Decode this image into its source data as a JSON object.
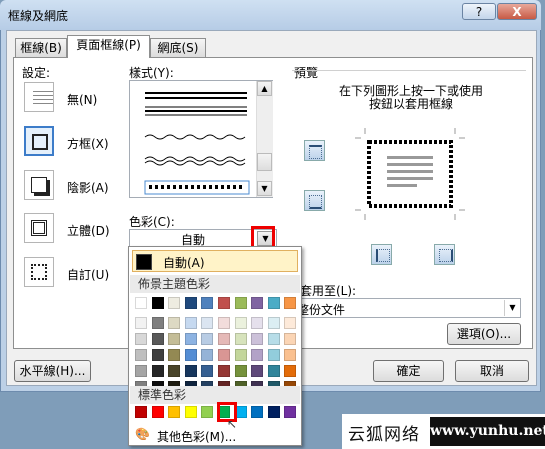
{
  "window": {
    "title": "框線及網底",
    "help": "?",
    "close": "X"
  },
  "tabs": [
    {
      "label": "框線(B)"
    },
    {
      "label": "頁面框線(P)"
    },
    {
      "label": "網底(S)"
    }
  ],
  "settings": {
    "heading": "設定:",
    "items": [
      {
        "label": "無(N)"
      },
      {
        "label": "方框(X)"
      },
      {
        "label": "陰影(A)"
      },
      {
        "label": "立體(D)"
      },
      {
        "label": "自訂(U)"
      }
    ]
  },
  "style": {
    "heading": "樣式(Y):"
  },
  "color": {
    "heading": "色彩(C):",
    "value": "自動"
  },
  "preview": {
    "heading": "預覽",
    "instruction_line1": "在下列圖形上按一下或使用",
    "instruction_line2": "按鈕以套用框線"
  },
  "apply_to": {
    "heading": "套用至(L):",
    "value": "整份文件"
  },
  "buttons": {
    "options": "選項(O)...",
    "horizontal_line": "水平線(H)...",
    "ok": "確定",
    "cancel": "取消"
  },
  "color_popup": {
    "auto_label": "自動(A)",
    "theme_heading": "佈景主題色彩",
    "standard_heading": "標準色彩",
    "more_colors": "其他色彩(M)...",
    "theme_top": [
      "#ffffff",
      "#000000",
      "#eeece1",
      "#1f497d",
      "#4f81bd",
      "#c0504d",
      "#9bbb59",
      "#8064a2",
      "#4bacc6",
      "#f79646"
    ],
    "theme_shades": [
      [
        "#f2f2f2",
        "#7f7f7f",
        "#ddd9c3",
        "#c6d9f0",
        "#dbe5f1",
        "#f2dcdb",
        "#ebf1dd",
        "#e5e0ec",
        "#dbeef3",
        "#fdeada"
      ],
      [
        "#d8d8d8",
        "#595959",
        "#c4bd97",
        "#8db3e2",
        "#b8cce4",
        "#e5b9b7",
        "#d7e3bc",
        "#ccc1d9",
        "#b7dde8",
        "#fbd5b5"
      ],
      [
        "#bfbfbf",
        "#3f3f3f",
        "#938953",
        "#548dd4",
        "#95b3d7",
        "#d99694",
        "#c3d69b",
        "#b2a2c7",
        "#92cddc",
        "#fac08f"
      ],
      [
        "#a5a5a5",
        "#262626",
        "#494429",
        "#17365d",
        "#366092",
        "#953734",
        "#76923c",
        "#5f497a",
        "#31859b",
        "#e36c09"
      ],
      [
        "#7f7f7f",
        "#0c0c0c",
        "#1d1b10",
        "#0f243e",
        "#244061",
        "#632423",
        "#4f6128",
        "#3f3151",
        "#205867",
        "#974806"
      ]
    ],
    "standard": [
      "#c00000",
      "#ff0000",
      "#ffc000",
      "#ffff00",
      "#92d050",
      "#00b050",
      "#00b0f0",
      "#0070c0",
      "#002060",
      "#7030a0"
    ],
    "selected_standard": "#00b050"
  },
  "watermark": {
    "left": "云狐网络",
    "right": "www.yunhu.net"
  }
}
